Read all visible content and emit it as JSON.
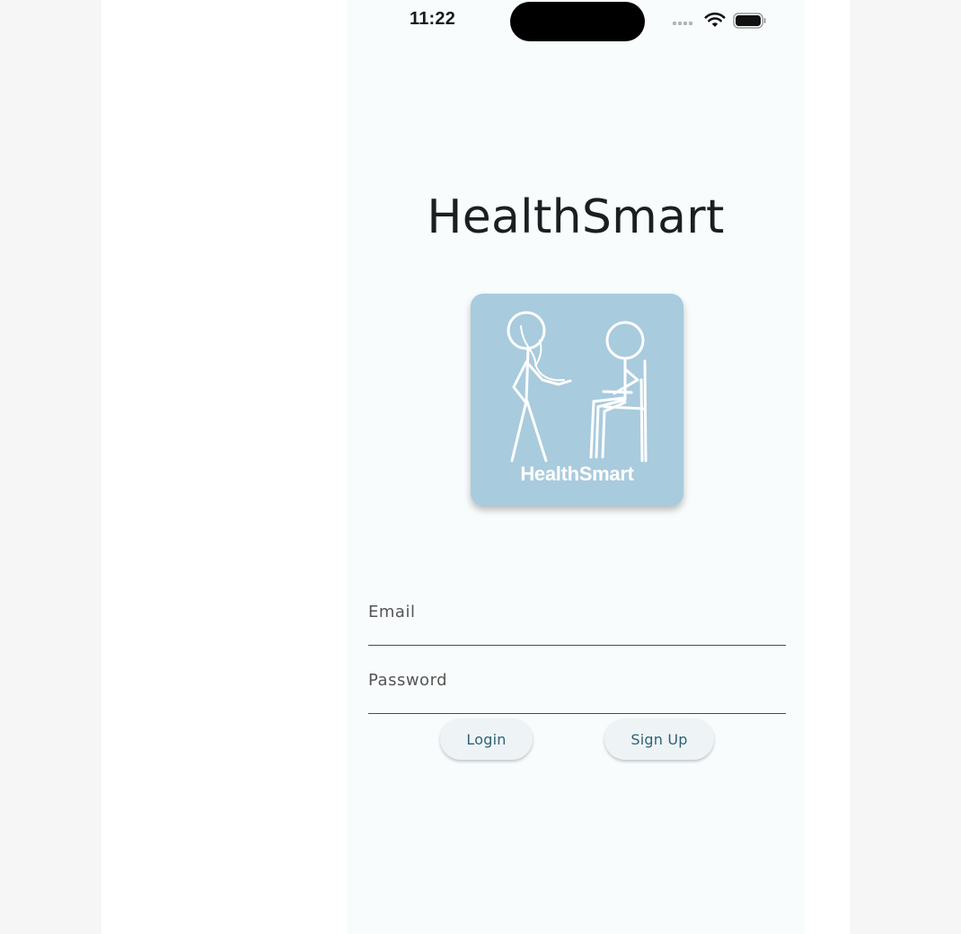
{
  "status_bar": {
    "time": "11:22",
    "icons": [
      "cellular-signal-icon",
      "wifi-icon",
      "battery-icon"
    ]
  },
  "app": {
    "title": "HealthSmart",
    "logo_text": "HealthSmart",
    "logo_background": "#a8cbdd",
    "background": "#f8fcfd"
  },
  "form": {
    "email_placeholder": "Email",
    "email_value": "",
    "password_placeholder": "Password",
    "password_value": ""
  },
  "buttons": {
    "login_label": "Login",
    "signup_label": "Sign Up",
    "label_color": "#2e6275"
  }
}
